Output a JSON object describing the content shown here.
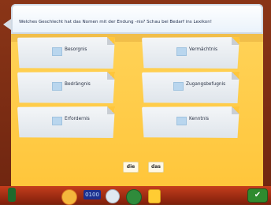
{
  "question": "Welches Geschlecht hat das Nomen mit der Endung -nis? Schau bei Bedarf ins Lexikon!",
  "cards": [
    {
      "word": "Besorgnis"
    },
    {
      "word": "Vermächtnis"
    },
    {
      "word": "Bedrängnis"
    },
    {
      "word": "Zugangsbefugnis"
    },
    {
      "word": "Erfordernis"
    },
    {
      "word": "Kenntnis"
    }
  ],
  "answers": [
    "die",
    "das"
  ],
  "timer": "0100",
  "confirm_symbol": "✔"
}
